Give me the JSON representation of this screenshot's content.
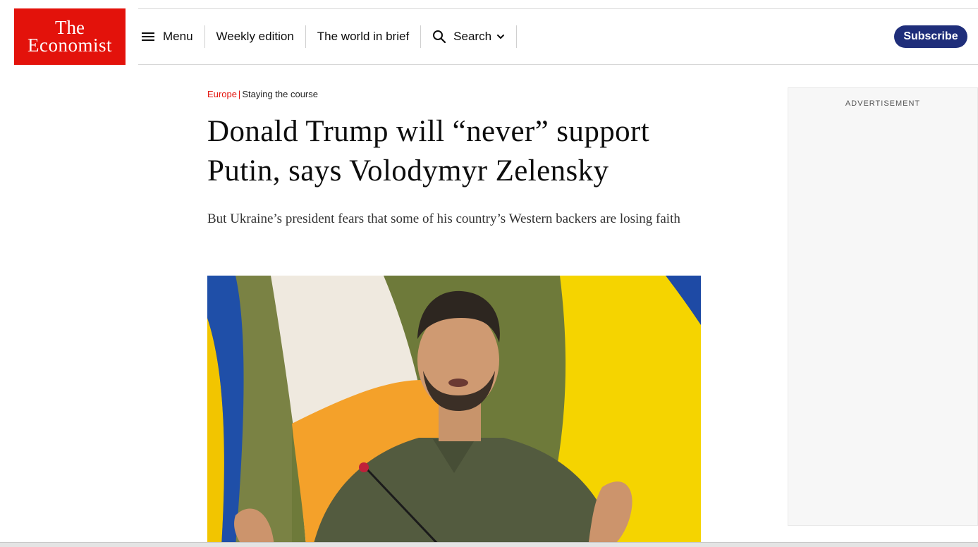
{
  "brand": {
    "line1": "The",
    "line2": "Economist",
    "color": "#e3120b"
  },
  "nav": {
    "menu_label": "Menu",
    "weekly_label": "Weekly edition",
    "world_label": "The world in brief",
    "search_label": "Search"
  },
  "subscribe_label": "Subscribe",
  "article": {
    "section": "Europe",
    "separator": "|",
    "fly_title": "Staying the course",
    "headline_line1": "Donald Trump will “never” support",
    "headline_line2": "Putin, says Volodymyr Zelensky",
    "standfirst": "But Ukraine’s president fears that some of his country’s Western backers are losing faith"
  },
  "advert": {
    "label": "ADVERTISEMENT"
  },
  "colors": {
    "accent": "#e3120b",
    "subscribe_bg": "#1f2e7a"
  }
}
